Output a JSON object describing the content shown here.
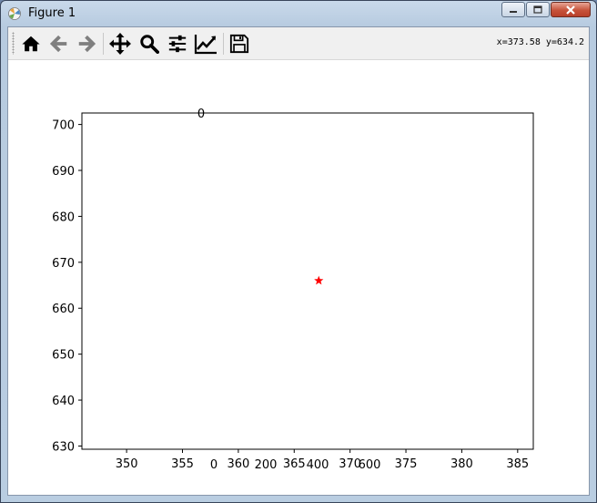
{
  "window": {
    "title": "Figure 1",
    "icon": "matplotlib-icon",
    "controls": [
      "minimize-icon",
      "maximize-icon",
      "close-icon"
    ]
  },
  "toolbar": {
    "buttons": [
      {
        "name": "home",
        "icon": "home-icon"
      },
      {
        "name": "back",
        "icon": "arrow-left-icon"
      },
      {
        "name": "forward",
        "icon": "arrow-right-icon"
      },
      {
        "name": "pan",
        "icon": "move-icon"
      },
      {
        "name": "zoom",
        "icon": "magnifier-icon"
      },
      {
        "name": "subplots",
        "icon": "sliders-icon"
      },
      {
        "name": "edit-axes",
        "icon": "line-chart-icon"
      },
      {
        "name": "save",
        "icon": "floppy-disk-icon"
      }
    ],
    "coordinates": "x=373.58 y=634.2"
  },
  "colors": {
    "marker": "#ff0000",
    "axes": "#000000"
  },
  "chart_data": {
    "type": "scatter",
    "marker": "star",
    "series": [
      {
        "x": [
          367.2
        ],
        "y": [
          666
        ]
      }
    ],
    "xlim": [
      346,
      386.4
    ],
    "ylim": [
      629.3,
      702.5
    ],
    "xticks": [
      350,
      355,
      360,
      365,
      370,
      375,
      380,
      385
    ],
    "yticks": [
      630,
      640,
      650,
      660,
      670,
      680,
      690,
      700
    ],
    "x_tick_labels": [
      "350",
      "355",
      "360",
      "365",
      "370",
      "375",
      "380",
      "385"
    ],
    "y_tick_labels": [
      "630",
      "640",
      "650",
      "660",
      "670",
      "680",
      "690",
      "700"
    ],
    "stray_labels": [
      "0",
      "0",
      "200",
      "400",
      "600"
    ]
  }
}
